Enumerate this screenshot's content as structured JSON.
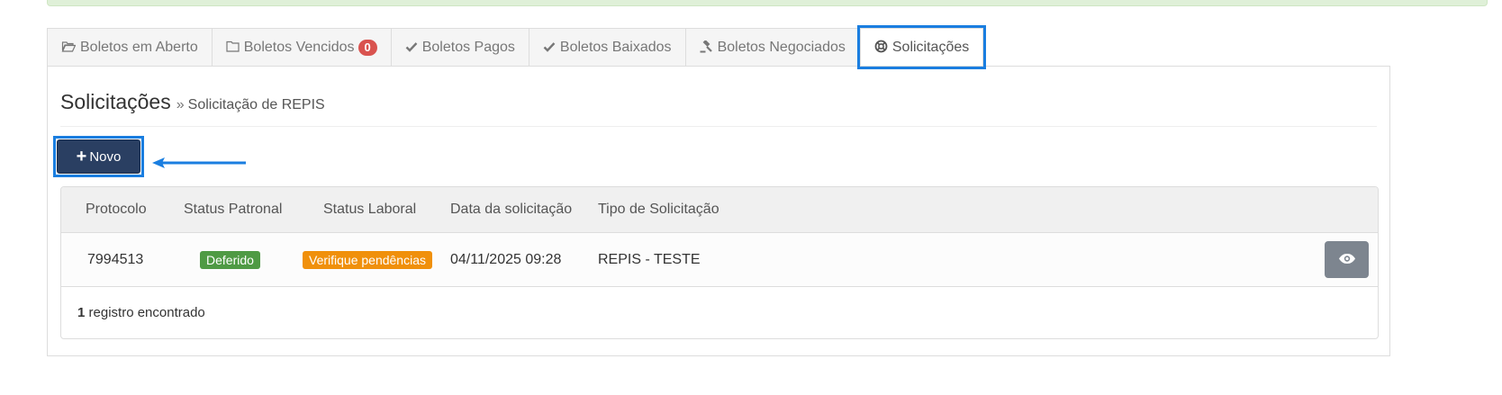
{
  "tabs": [
    {
      "icon": "folder-open-icon",
      "label": "Boletos em Aberto",
      "badge": null
    },
    {
      "icon": "folder-icon",
      "label": "Boletos Vencidos",
      "badge": "0"
    },
    {
      "icon": "check-icon",
      "label": "Boletos Pagos",
      "badge": null
    },
    {
      "icon": "check-icon",
      "label": "Boletos Baixados",
      "badge": null
    },
    {
      "icon": "gavel-icon",
      "label": "Boletos Negociados",
      "badge": null
    },
    {
      "icon": "life-ring-icon",
      "label": "Solicitações",
      "badge": null
    }
  ],
  "active_tab": "Solicitações",
  "page": {
    "title": "Solicitações",
    "separator": "»",
    "subtitle": "Solicitação de REPIS"
  },
  "toolbar": {
    "novo_label": "Novo"
  },
  "table": {
    "headers": [
      "Protocolo",
      "Status Patronal",
      "Status Laboral",
      "Data da solicitação",
      "Tipo de Solicitação"
    ],
    "rows": [
      {
        "protocolo": "7994513",
        "status_patronal": "Deferido",
        "status_laboral": "Verifique pendências",
        "data": "04/11/2025 09:28",
        "tipo": "REPIS - TESTE"
      }
    ],
    "footer_count": "1",
    "footer_text": "registro encontrado"
  },
  "colors": {
    "accent_highlight": "#1a7ee0",
    "primary_button": "#2a3f62",
    "badge_danger": "#d9534f",
    "label_success": "#4f9a44",
    "label_warning": "#f0900b",
    "view_button": "#7d858f"
  }
}
